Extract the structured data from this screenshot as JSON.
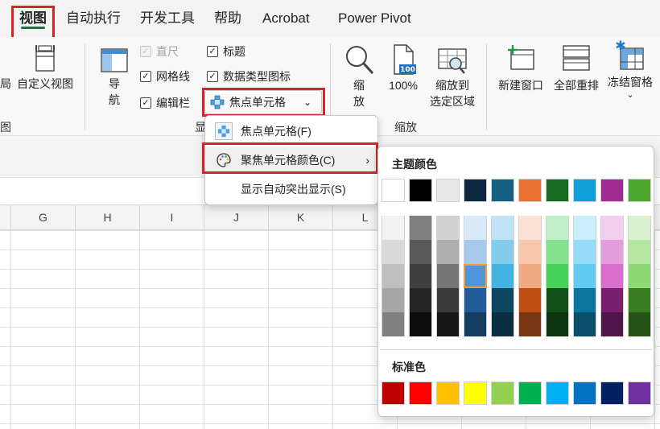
{
  "tabs": [
    "视图",
    "自动执行",
    "开发工具",
    "帮助",
    "Acrobat",
    "Power Pivot"
  ],
  "ribbon": {
    "partial_left": "局",
    "custom_view": "自定义视图",
    "partial_group_left": "图",
    "nav_line1": "导",
    "nav_line2": "航",
    "ruler": "直尺",
    "gridlines": "网格线",
    "formula_bar": "编辑栏",
    "headings": "标题",
    "datatype_icons": "数据类型图标",
    "focus_cell": "焦点单元格",
    "show_group_partial": "显",
    "zoom_line1": "缩",
    "zoom_line2": "放",
    "zoom_100": "100%",
    "zoom_sel_line1": "缩放到",
    "zoom_sel_line2": "选定区域",
    "zoom_group": "缩放",
    "new_window": "新建窗口",
    "arrange_all": "全部重排",
    "freeze_panes": "冻结窗格",
    "icons": {
      "custom_view": "custom-view-icon",
      "nav": "navigation-pane-icon",
      "zoom": "magnifier-icon",
      "zoom100": "zoom-100-icon",
      "zoom_sel": "zoom-selection-icon",
      "new_window": "new-window-icon",
      "arrange": "arrange-all-icon",
      "freeze": "freeze-panes-icon",
      "focus": "focus-cell-icon"
    }
  },
  "columns": [
    "G",
    "H",
    "I",
    "J",
    "K",
    "L"
  ],
  "menu": {
    "item1": "焦点单元格(F)",
    "item2": "聚焦单元格颜色(C)",
    "item3": "显示自动突出显示(S)"
  },
  "palette": {
    "theme_title": "主题颜色",
    "standard_title": "标准色",
    "theme_top": [
      "#FFFFFF",
      "#000000",
      "#E8E8E8",
      "#0E2841",
      "#156082",
      "#E97132",
      "#196B24",
      "#0F9ED5",
      "#A02B93",
      "#4EA72E"
    ],
    "theme_shades": [
      [
        "#F2F2F2",
        "#808080",
        "#D1D1D1",
        "#DAE9F8",
        "#C0E4F5",
        "#FBE2D5",
        "#C1F0C8",
        "#CAEEFB",
        "#F2CEEF",
        "#DAF2D0"
      ],
      [
        "#D9D9D9",
        "#595959",
        "#ADADAD",
        "#A6C9EC",
        "#83CCEB",
        "#F7C7AC",
        "#83E28E",
        "#94DCF8",
        "#E59EDD",
        "#B5E6A2"
      ],
      [
        "#BFBFBF",
        "#404040",
        "#757575",
        "#4E95D9",
        "#44B3E1",
        "#F1A983",
        "#47D359",
        "#61CBF3",
        "#D86DCD",
        "#8ED973"
      ],
      [
        "#A6A6A6",
        "#262626",
        "#3A3A3A",
        "#215C98",
        "#0F4761",
        "#C04F15",
        "#124F1A",
        "#0B76A0",
        "#78206E",
        "#3B7D23"
      ],
      [
        "#808080",
        "#0D0D0D",
        "#161616",
        "#153D64",
        "#0A2F40",
        "#783612",
        "#0C3511",
        "#074F6A",
        "#501549",
        "#275317"
      ]
    ],
    "selected": "#4E95D9",
    "standard": [
      "#C00000",
      "#FF0000",
      "#FFC000",
      "#FFFF00",
      "#92D050",
      "#00B050",
      "#00B0F0",
      "#0070C0",
      "#002060",
      "#7030A0"
    ]
  }
}
